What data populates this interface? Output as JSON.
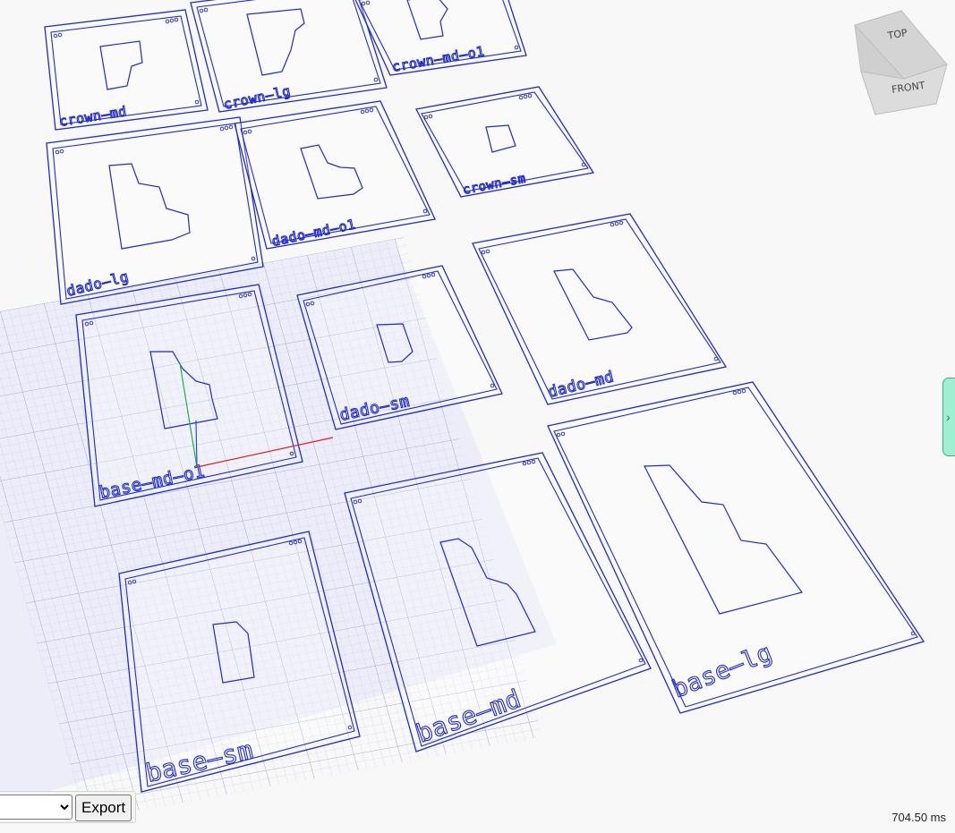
{
  "panels": [
    {
      "id": "crown-md",
      "label": "crown—md"
    },
    {
      "id": "crown-lg",
      "label": "crown—lg"
    },
    {
      "id": "crown-md-o1",
      "label": "crown—md—o1"
    },
    {
      "id": "dado-lg",
      "label": "dado—lg"
    },
    {
      "id": "dado-md-o1",
      "label": "dado—md—o1"
    },
    {
      "id": "crown-sm",
      "label": "crown—sm"
    },
    {
      "id": "base-md-o1",
      "label": "base—md—o1"
    },
    {
      "id": "dado-sm",
      "label": "dado—sm"
    },
    {
      "id": "dado-md",
      "label": "dado—md"
    },
    {
      "id": "base-sm",
      "label": "base—sm"
    },
    {
      "id": "base-md",
      "label": "base—md"
    },
    {
      "id": "base-lg",
      "label": "base—lg"
    }
  ],
  "nav_cube": {
    "top_label": "TOP",
    "front_label": "FRONT"
  },
  "toolbar": {
    "select_value": "",
    "export_label": "Export"
  },
  "status": {
    "render_time": "704.50 ms"
  },
  "colors": {
    "outline": "#1f2ad4",
    "grid": "#c8cbe4",
    "axis_x": "#e02020",
    "axis_y": "#20b040",
    "axis_z": "#2050e0"
  }
}
